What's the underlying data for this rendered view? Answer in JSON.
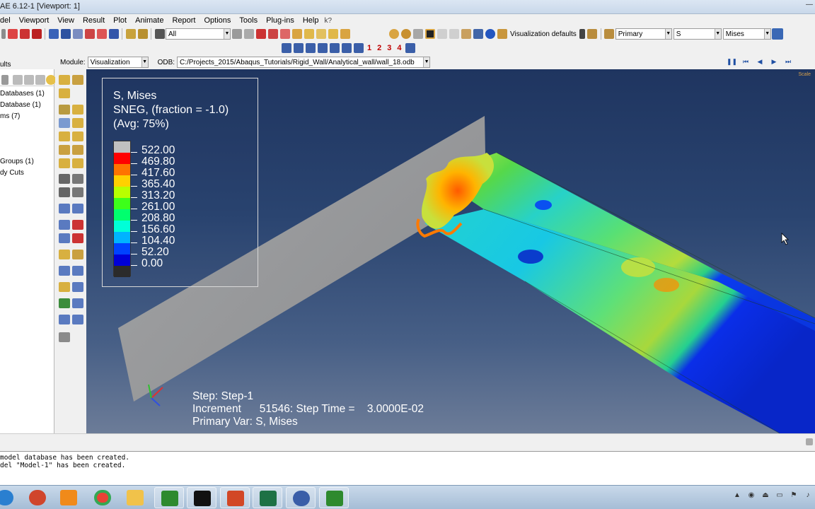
{
  "window": {
    "title": "AE 6.12-1 [Viewport: 1]",
    "close_glyph": "—"
  },
  "menu": {
    "items": [
      "del",
      "Viewport",
      "View",
      "Result",
      "Plot",
      "Animate",
      "Report",
      "Options",
      "Tools",
      "Plug-ins",
      "Help"
    ],
    "help_glyph": "k?"
  },
  "toolbar": {
    "selection_filter": "All",
    "visualization_defaults": "Visualization defaults",
    "field_category": "Primary",
    "field_variable": "S",
    "field_invariant": "Mises",
    "numbers": [
      "1",
      "2",
      "3",
      "4"
    ]
  },
  "module_bar": {
    "module_label": "Module:",
    "module_value": "Visualization",
    "odb_label": "ODB:",
    "odb_value": "C:/Projects_2015/Abaqus_Tutorials/Rigid_Wall/Analytical_wall/wall_18.odb"
  },
  "tree": {
    "tab_label": "ults",
    "items": [
      "Databases (1)",
      "Database (1)",
      "ms (7)",
      "Groups (1)",
      "dy Cuts"
    ]
  },
  "legend": {
    "line1": "S, Mises",
    "line2": "SNEG, (fraction = -1.0)",
    "line3": "(Avg: 75%)",
    "values": [
      "522.00",
      "469.80",
      "417.60",
      "365.40",
      "313.20",
      "261.00",
      "208.80",
      "156.60",
      "104.40",
      "52.20",
      "0.00"
    ],
    "colors": [
      "#c0c0c0",
      "#ff0000",
      "#ff7300",
      "#ffd000",
      "#b8ff00",
      "#3dff1a",
      "#00ff6e",
      "#00ffd8",
      "#00b3ff",
      "#0042ff",
      "#0000d8",
      "#2b2b2b"
    ]
  },
  "step_info": {
    "step": "Step: Step-1",
    "increment": "Increment      51546: Step Time =    3.0000E-02",
    "primary": "Primary Var: S, Mises"
  },
  "viewport": {
    "scale_note": "Scale",
    "background": "#2a4470"
  },
  "messages": [
    "model database has been created.",
    "del \"Model-1\" has been created."
  ],
  "taskbar": {
    "apps": [
      "start",
      "snipping-tool",
      "media-player",
      "chrome",
      "explorer",
      "abaqus",
      "command-prompt",
      "powerpoint",
      "excel",
      "network-tool",
      "abaqus-cae"
    ]
  }
}
